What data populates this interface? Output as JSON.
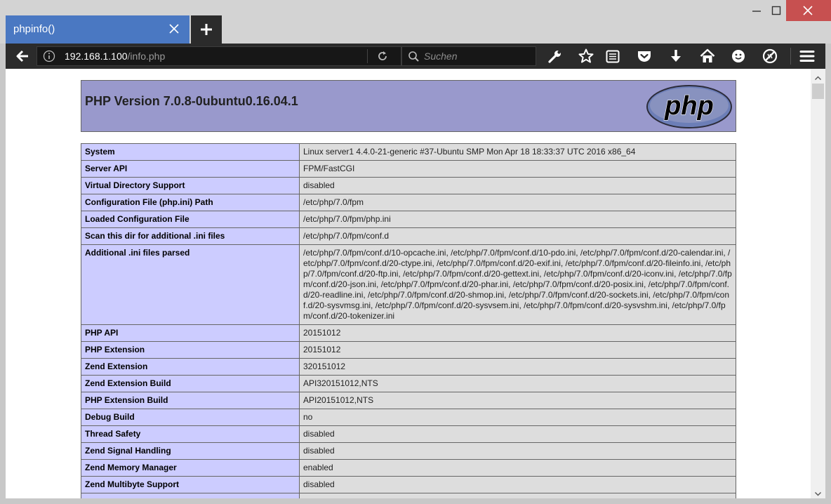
{
  "browser": {
    "tab_title": "phpinfo()",
    "url_host": "192.168.1.100",
    "url_path": "/info.php",
    "search_placeholder": "Suchen"
  },
  "page": {
    "heading": "PHP Version 7.0.8-0ubuntu0.16.04.1",
    "logo_text": "php",
    "rows": [
      {
        "label": "System",
        "value": "Linux server1 4.4.0-21-generic #37-Ubuntu SMP Mon Apr 18 18:33:37 UTC 2016 x86_64"
      },
      {
        "label": "Server API",
        "value": "FPM/FastCGI"
      },
      {
        "label": "Virtual Directory Support",
        "value": "disabled"
      },
      {
        "label": "Configuration File (php.ini) Path",
        "value": "/etc/php/7.0/fpm"
      },
      {
        "label": "Loaded Configuration File",
        "value": "/etc/php/7.0/fpm/php.ini"
      },
      {
        "label": "Scan this dir for additional .ini files",
        "value": "/etc/php/7.0/fpm/conf.d"
      },
      {
        "label": "Additional .ini files parsed",
        "value": "/etc/php/7.0/fpm/conf.d/10-opcache.ini, /etc/php/7.0/fpm/conf.d/10-pdo.ini, /etc/php/7.0/fpm/conf.d/20-calendar.ini, /etc/php/7.0/fpm/conf.d/20-ctype.ini, /etc/php/7.0/fpm/conf.d/20-exif.ini, /etc/php/7.0/fpm/conf.d/20-fileinfo.ini, /etc/php/7.0/fpm/conf.d/20-ftp.ini, /etc/php/7.0/fpm/conf.d/20-gettext.ini, /etc/php/7.0/fpm/conf.d/20-iconv.ini, /etc/php/7.0/fpm/conf.d/20-json.ini, /etc/php/7.0/fpm/conf.d/20-phar.ini, /etc/php/7.0/fpm/conf.d/20-posix.ini, /etc/php/7.0/fpm/conf.d/20-readline.ini, /etc/php/7.0/fpm/conf.d/20-shmop.ini, /etc/php/7.0/fpm/conf.d/20-sockets.ini, /etc/php/7.0/fpm/conf.d/20-sysvmsg.ini, /etc/php/7.0/fpm/conf.d/20-sysvsem.ini, /etc/php/7.0/fpm/conf.d/20-sysvshm.ini, /etc/php/7.0/fpm/conf.d/20-tokenizer.ini"
      },
      {
        "label": "PHP API",
        "value": "20151012"
      },
      {
        "label": "PHP Extension",
        "value": "20151012"
      },
      {
        "label": "Zend Extension",
        "value": "320151012"
      },
      {
        "label": "Zend Extension Build",
        "value": "API320151012,NTS"
      },
      {
        "label": "PHP Extension Build",
        "value": "API20151012,NTS"
      },
      {
        "label": "Debug Build",
        "value": "no"
      },
      {
        "label": "Thread Safety",
        "value": "disabled"
      },
      {
        "label": "Zend Signal Handling",
        "value": "disabled"
      },
      {
        "label": "Zend Memory Manager",
        "value": "enabled"
      },
      {
        "label": "Zend Multibyte Support",
        "value": "disabled"
      },
      {
        "label": "",
        "value": ""
      }
    ]
  },
  "icons": [
    "close-icon",
    "plus-icon",
    "minimize-icon",
    "maximize-icon",
    "back-arrow-icon",
    "info-icon",
    "reload-icon",
    "search-icon",
    "wrench-icon",
    "star-icon",
    "reading-list-icon",
    "pocket-icon",
    "download-icon",
    "home-icon",
    "smiley-icon",
    "disabled-addon-icon",
    "hamburger-menu-icon"
  ],
  "colors": {
    "tab_active": "#4a78c2",
    "toolbar": "#2b2b2b",
    "window_close": "#c75050",
    "php_header": "#9999cc",
    "label_cell": "#ccccff",
    "value_cell": "#dddddd"
  }
}
